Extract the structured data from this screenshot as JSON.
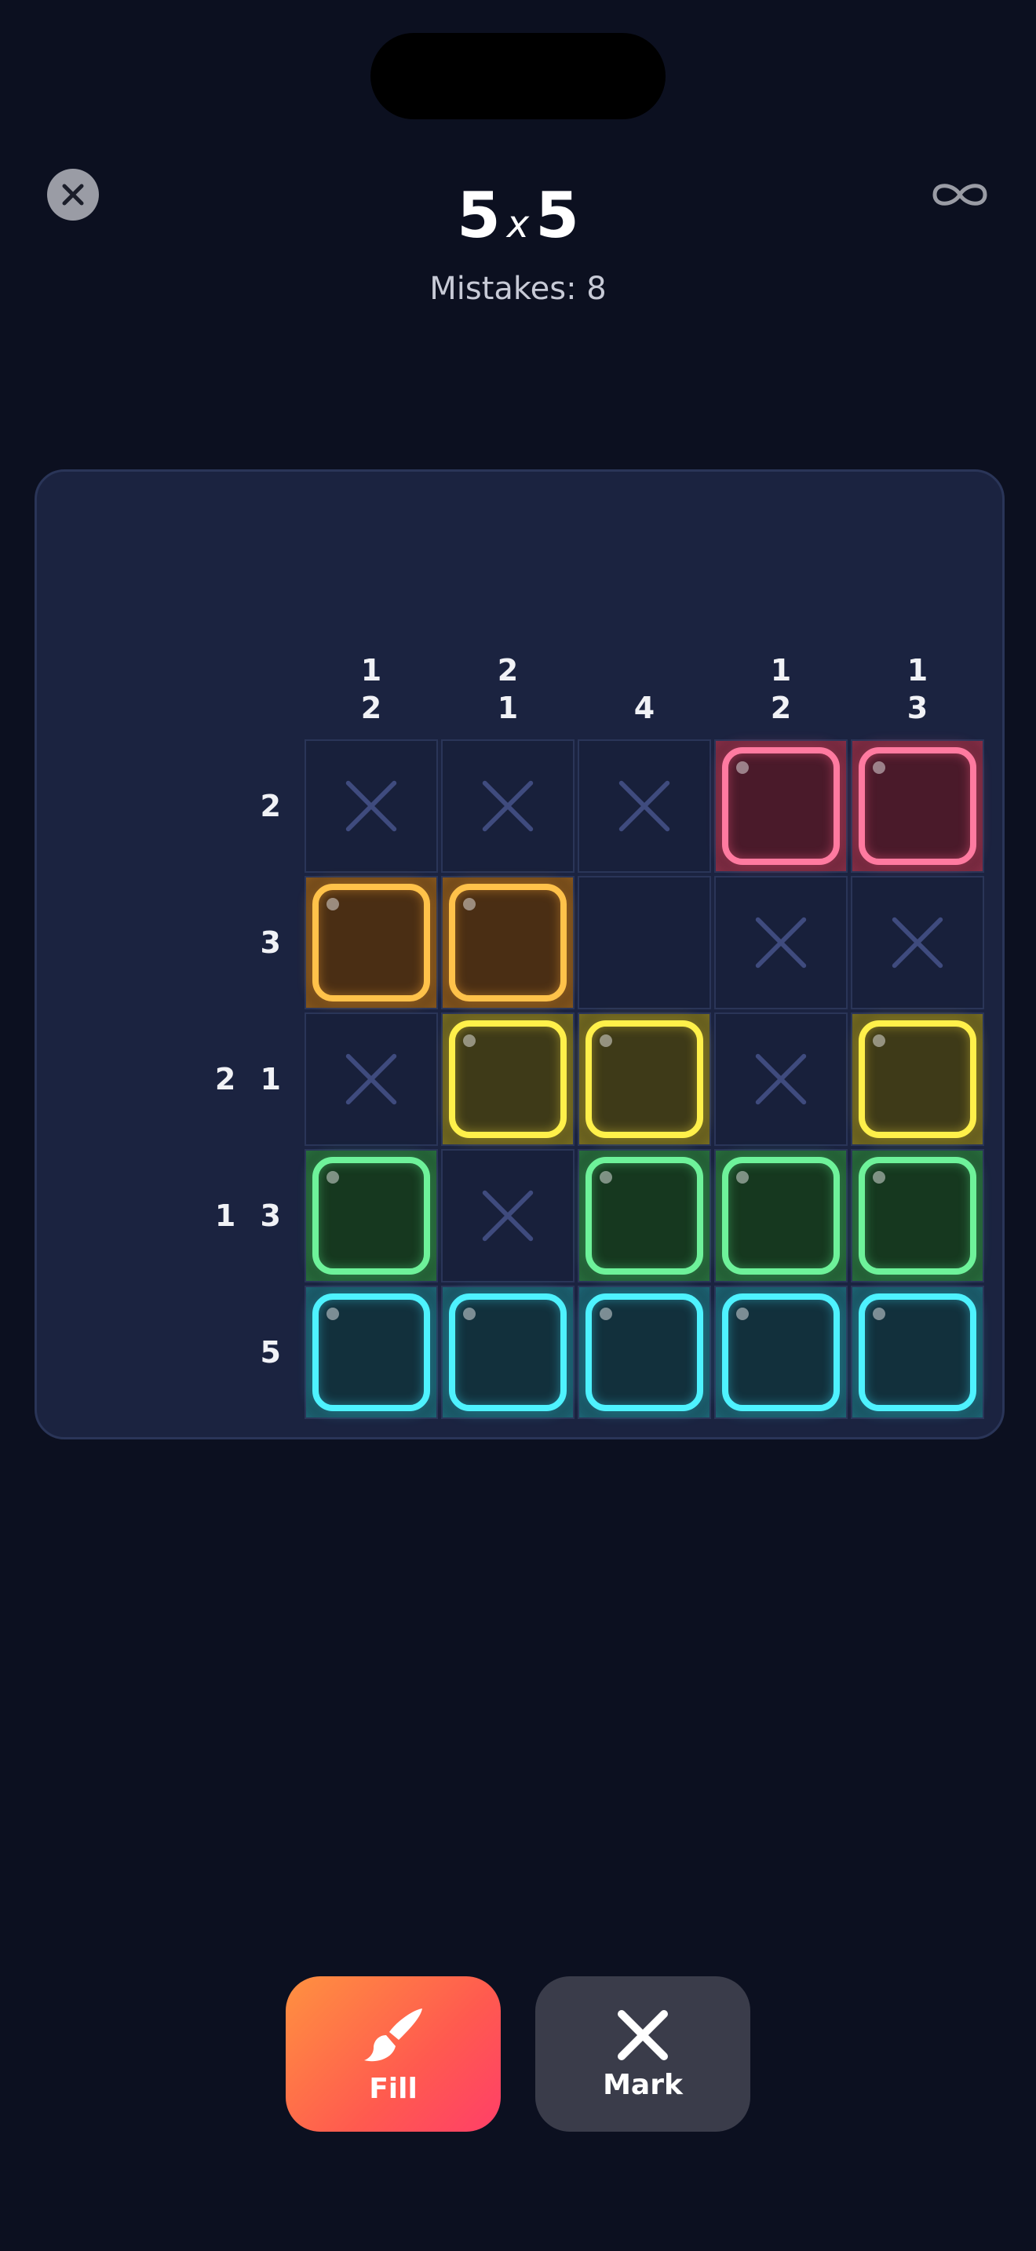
{
  "header": {
    "title_left": "5",
    "title_times": "x",
    "title_right": "5",
    "mistakes_label": "Mistakes:",
    "mistakes_value": "8"
  },
  "icons": {
    "close": "close-icon",
    "mode": "infinity-icon",
    "fill": "paintbrush-icon",
    "mark": "x-icon"
  },
  "puzzle": {
    "column_clues": [
      [
        "1",
        "2"
      ],
      [
        "2",
        "1"
      ],
      [
        "4"
      ],
      [
        "1",
        "2"
      ],
      [
        "1",
        "3"
      ]
    ],
    "row_clues": [
      "2",
      "3",
      "2 1",
      "1 3",
      "5"
    ],
    "cells": [
      [
        "mark",
        "mark",
        "mark",
        "pink",
        "pink"
      ],
      [
        "orange",
        "orange",
        "empty",
        "mark",
        "mark"
      ],
      [
        "mark",
        "yellow",
        "yellow",
        "mark",
        "yellow"
      ],
      [
        "green",
        "mark",
        "green",
        "green",
        "green"
      ],
      [
        "cyan",
        "cyan",
        "cyan",
        "cyan",
        "cyan"
      ]
    ]
  },
  "colors": {
    "pink": {
      "border": "#ff7aa0",
      "fill": "#4a1a2a",
      "glow": "rgba(255,90,130,0.45)"
    },
    "orange": {
      "border": "#ffc24a",
      "fill": "#4a2e14",
      "glow": "rgba(255,170,50,0.45)"
    },
    "yellow": {
      "border": "#fff04a",
      "fill": "#3e3a18",
      "glow": "rgba(255,230,60,0.40)"
    },
    "green": {
      "border": "#6ef29a",
      "fill": "#16381f",
      "glow": "rgba(90,240,140,0.40)"
    },
    "cyan": {
      "border": "#4ef2ff",
      "fill": "#12303c",
      "glow": "rgba(60,230,255,0.40)"
    },
    "mark": "#3f4b7e"
  },
  "controls": {
    "fill_label": "Fill",
    "mark_label": "Mark"
  }
}
